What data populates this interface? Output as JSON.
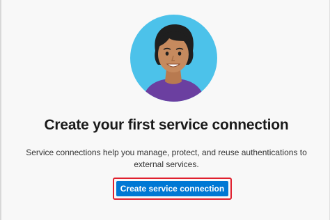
{
  "empty_state": {
    "illustration_icon": "person-avatar-icon",
    "title": "Create your first service connection",
    "description": "Service connections help you manage, protect, and reuse authentications to external services.",
    "button_label": "Create service connection"
  },
  "colors": {
    "accent": "#0078d4",
    "highlight_outline": "#e0202e",
    "avatar_background": "#4cc2ea",
    "shirt": "#6b3fa0",
    "skin": "#c68a5e",
    "hair": "#1f1f1f"
  }
}
